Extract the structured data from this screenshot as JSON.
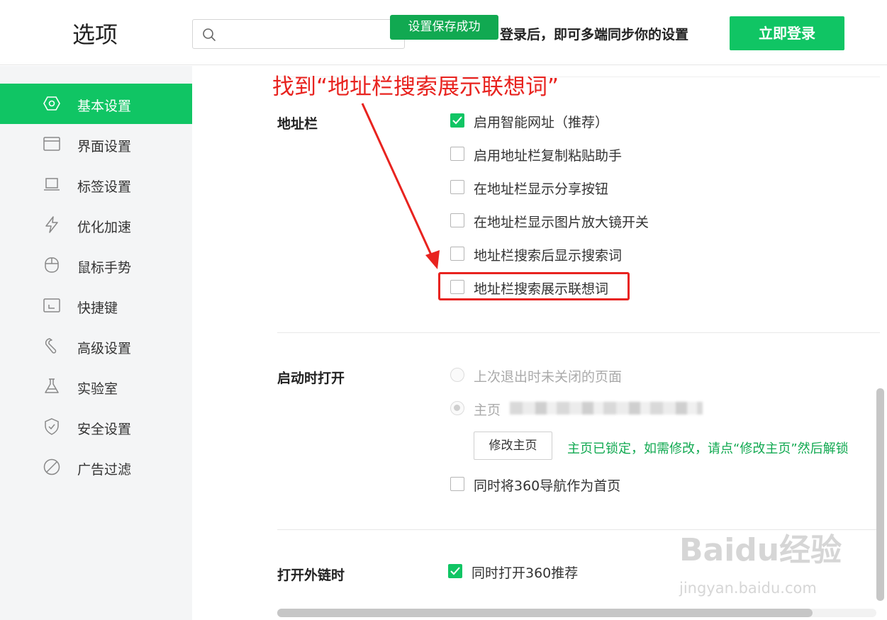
{
  "header": {
    "title": "选项",
    "search_placeholder": "",
    "toast": "设置保存成功",
    "sync_text": "登录后，即可多端同步你的设置",
    "login_button": "立即登录"
  },
  "sidebar": {
    "items": [
      {
        "label": "基本设置",
        "icon": "hexagon-gear-icon",
        "active": true
      },
      {
        "label": "界面设置",
        "icon": "window-icon",
        "active": false
      },
      {
        "label": "标签设置",
        "icon": "tab-icon",
        "active": false
      },
      {
        "label": "优化加速",
        "icon": "lightning-icon",
        "active": false
      },
      {
        "label": "鼠标手势",
        "icon": "mouse-icon",
        "active": false
      },
      {
        "label": "快捷键",
        "icon": "keyboard-icon",
        "active": false
      },
      {
        "label": "高级设置",
        "icon": "wrench-icon",
        "active": false
      },
      {
        "label": "实验室",
        "icon": "flask-icon",
        "active": false
      },
      {
        "label": "安全设置",
        "icon": "shield-icon",
        "active": false
      },
      {
        "label": "广告过滤",
        "icon": "block-icon",
        "active": false
      }
    ]
  },
  "annotation": "找到“地址栏搜索展示联想词”",
  "address_bar": {
    "title": "地址栏",
    "options": [
      {
        "label": "启用智能网址（推荐）",
        "checked": true
      },
      {
        "label": "启用地址栏复制粘贴助手",
        "checked": false
      },
      {
        "label": "在地址栏显示分享按钮",
        "checked": false
      },
      {
        "label": "在地址栏显示图片放大镜开关",
        "checked": false
      },
      {
        "label": "地址栏搜索后显示搜索词",
        "checked": false
      },
      {
        "label": "地址栏搜索展示联想词",
        "checked": false
      }
    ]
  },
  "startup": {
    "title": "启动时打开",
    "option_last_session": "上次退出时未关闭的页面",
    "option_homepage": "主页",
    "edit_home_button": "修改主页",
    "lock_note": "主页已锁定，如需修改，请点“修改主页”然后解锁",
    "nav_as_home": "同时将360导航作为首页"
  },
  "external_links": {
    "title": "打开外链时",
    "option": "同时打开360推荐"
  },
  "watermark": {
    "logo": "Baidu经验",
    "url": "jingyan.baidu.com"
  },
  "colors": {
    "accent": "#10c564",
    "annotation_red": "#e8231f",
    "note_green": "#11a951"
  }
}
